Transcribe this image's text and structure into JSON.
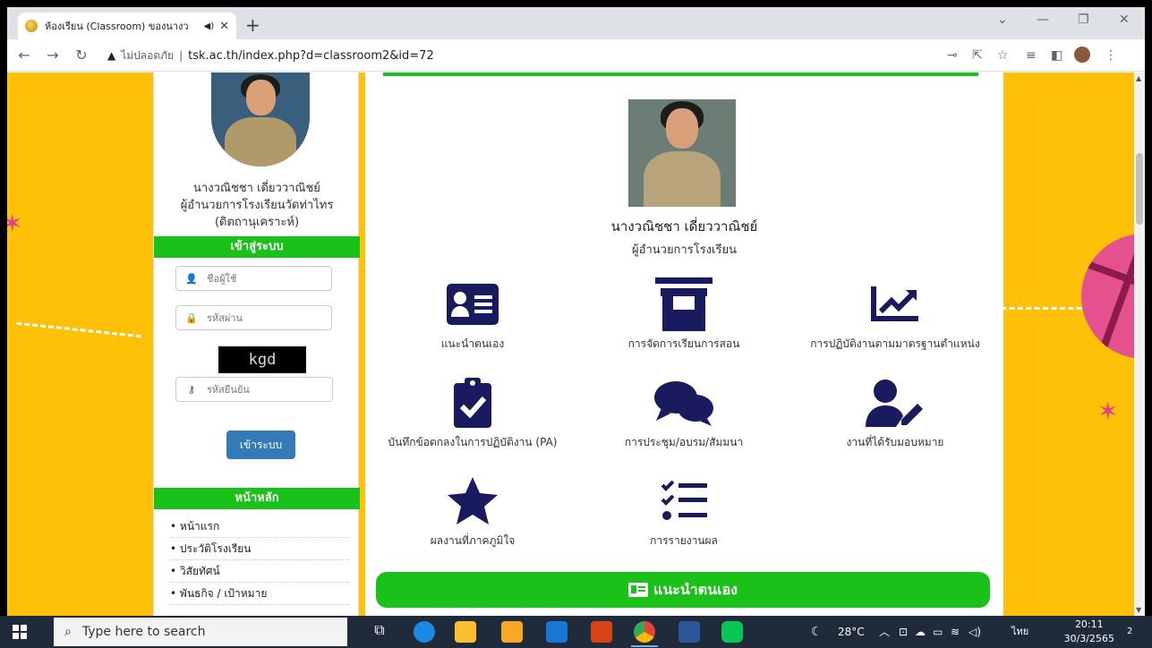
{
  "browser": {
    "tab_title": "ห้องเรียน (Classroom) ของนางว",
    "audio_icon": "speaker-icon",
    "security_label": "ไม่ปลอดภัย",
    "url": "tsk.ac.th/index.php?d=classroom2&id=72"
  },
  "sidebar": {
    "person_name": "นางวณิชชา เดี่ยววาณิชย์",
    "person_role": "ผู้อำนวยการโรงเรียนวัดท่าไทร",
    "person_school": "(ดิตถานุเคราะห์)",
    "login_header": "เข้าสู่ระบบ",
    "username_placeholder": "ชื่อผู้ใช้",
    "password_placeholder": "รหัสผ่าน",
    "captcha_text": "kgd",
    "confirm_placeholder": "รหัสยืนยัน",
    "login_button": "เข้าระบบ",
    "menu_header": "หน้าหลัก",
    "menu": [
      "หน้าแรก",
      "ประวัติโรงเรียน",
      "วิสัยทัศน์",
      "พันธกิจ / เป้าหมาย"
    ]
  },
  "main": {
    "name": "นางวณิชชา เดี่ยววาณิชย์",
    "role": "ผู้อำนวยการโรงเรียน",
    "items": [
      {
        "label": "แนะนำตนเอง",
        "icon": "id-card-icon"
      },
      {
        "label": "การจัดการเรียนการสอน",
        "icon": "torii-gate-icon"
      },
      {
        "label": "การปฏิบัติงานตามมาตรฐานตำแหน่ง",
        "icon": "chart-line-icon"
      },
      {
        "label": "บันทึกข้อตกลงในการปฏิบัติงาน (PA)",
        "icon": "clipboard-check-icon"
      },
      {
        "label": "การประชุม/อบรม/สัมมนา",
        "icon": "comments-icon"
      },
      {
        "label": "งานที่ได้รับมอบหมาย",
        "icon": "user-edit-icon"
      },
      {
        "label": "ผลงานที่ภาคภูมิใจ",
        "icon": "star-icon"
      },
      {
        "label": "การรายงานผล",
        "icon": "checklist-icon"
      }
    ],
    "banner": "แนะนำตนเอง"
  },
  "taskbar": {
    "search_placeholder": "Type here to search",
    "weather": "28°C",
    "lang": "ไทย",
    "time": "20:11",
    "date": "30/3/2565",
    "notif_count": "2"
  },
  "colors": {
    "accent_green": "#19c119",
    "navy": "#1a1a5e",
    "page_bg": "#ffc107",
    "button_blue": "#337ab7"
  }
}
